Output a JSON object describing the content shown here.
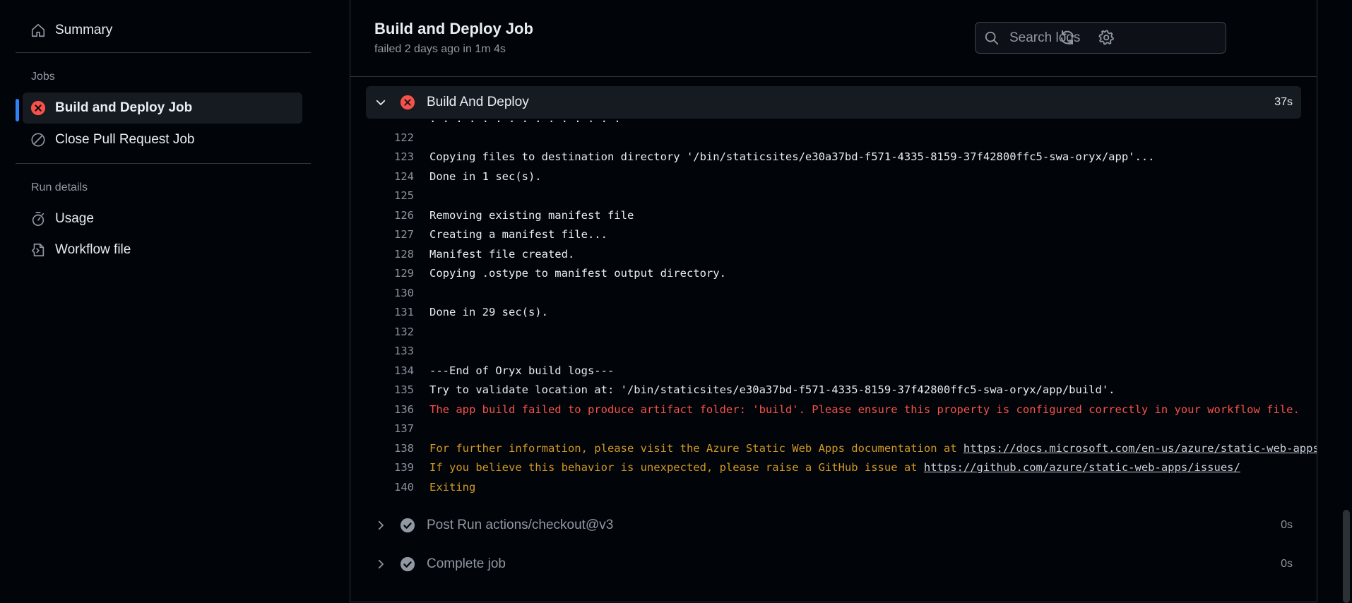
{
  "sidebar": {
    "summary_label": "Summary",
    "jobs_heading": "Jobs",
    "jobs": [
      {
        "label": "Build and Deploy Job"
      },
      {
        "label": "Close Pull Request Job"
      }
    ],
    "run_details_heading": "Run details",
    "details": [
      {
        "label": "Usage"
      },
      {
        "label": "Workflow file"
      }
    ]
  },
  "header": {
    "title": "Build and Deploy Job",
    "subtitle": "failed 2 days ago in 1m 4s",
    "search_placeholder": "Search logs"
  },
  "step": {
    "name": "Build And Deploy",
    "duration": "37s"
  },
  "log_partial_top": ". . . . . . . . . . . . . . .",
  "log_lines": [
    {
      "n": "122",
      "t": ""
    },
    {
      "n": "123",
      "t": "Copying files to destination directory '/bin/staticsites/e30a37bd-f571-4335-8159-37f42800ffc5-swa-oryx/app'..."
    },
    {
      "n": "124",
      "t": "Done in 1 sec(s)."
    },
    {
      "n": "125",
      "t": ""
    },
    {
      "n": "126",
      "t": "Removing existing manifest file"
    },
    {
      "n": "127",
      "t": "Creating a manifest file..."
    },
    {
      "n": "128",
      "t": "Manifest file created."
    },
    {
      "n": "129",
      "t": "Copying .ostype to manifest output directory."
    },
    {
      "n": "130",
      "t": ""
    },
    {
      "n": "131",
      "t": "Done in 29 sec(s)."
    },
    {
      "n": "132",
      "t": ""
    },
    {
      "n": "133",
      "t": ""
    },
    {
      "n": "134",
      "t": "---End of Oryx build logs---"
    },
    {
      "n": "135",
      "t": "Try to validate location at: '/bin/staticsites/e30a37bd-f571-4335-8159-37f42800ffc5-swa-oryx/app/build'."
    },
    {
      "n": "136",
      "t": "The app build failed to produce artifact folder: 'build'. Please ensure this property is configured correctly in your workflow file."
    },
    {
      "n": "137",
      "t": ""
    },
    {
      "n": "138",
      "t": "For further information, please visit the Azure Static Web Apps documentation at ",
      "link": "https://docs.microsoft.com/en-us/azure/static-web-apps/"
    },
    {
      "n": "139",
      "t": "If you believe this behavior is unexpected, please raise a GitHub issue at ",
      "link": "https://github.com/azure/static-web-apps/issues/"
    },
    {
      "n": "140",
      "t": "Exiting"
    }
  ],
  "later_steps": [
    {
      "name": "Post Run actions/checkout@v3",
      "duration": "0s"
    },
    {
      "name": "Complete job",
      "duration": "0s"
    }
  ],
  "colors": {
    "accent": "#2f81f7",
    "error": "#f85149",
    "warning": "#d29922",
    "success_icon": "#9198a1"
  }
}
